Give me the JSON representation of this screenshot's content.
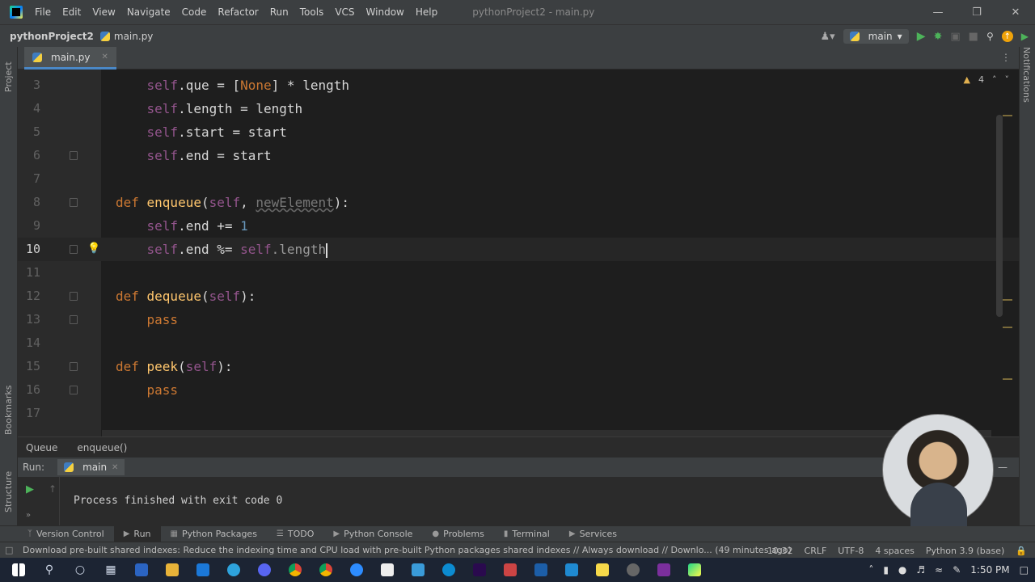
{
  "titlebar": {
    "menus": [
      "File",
      "Edit",
      "View",
      "Navigate",
      "Code",
      "Refactor",
      "Run",
      "Tools",
      "VCS",
      "Window",
      "Help"
    ],
    "window_title": "pythonProject2 - main.py"
  },
  "navbar": {
    "project": "pythonProject2",
    "file": "main.py",
    "run_config": "main"
  },
  "left_strip": {
    "project": "Project",
    "bookmarks": "Bookmarks",
    "structure": "Structure"
  },
  "right_strip": {
    "notifications": "Notifications"
  },
  "editor": {
    "tab": "main.py",
    "warnings": "4",
    "lines": [
      {
        "n": "3",
        "indent": "    ",
        "a": "self",
        "b": ".que = [",
        "c": "None",
        "d": "] * length"
      },
      {
        "n": "4",
        "indent": "    ",
        "a": "self",
        "b": ".length = length"
      },
      {
        "n": "5",
        "indent": "    ",
        "a": "self",
        "b": ".start = start"
      },
      {
        "n": "6",
        "indent": "    ",
        "a": "self",
        "b": ".end = start"
      },
      {
        "n": "7"
      },
      {
        "n": "8",
        "kw": "def ",
        "fn": "enqueue",
        "p1": "(",
        "s1": "self",
        ",": ", ",
        "un": "newElement",
        "p2": "):"
      },
      {
        "n": "9",
        "indent": "    ",
        "a": "self",
        "b": ".end += ",
        "num": "1"
      },
      {
        "n": "10",
        "indent": "    ",
        "a": "self",
        "b": ".end %= ",
        "a2": "self",
        "b2": ".length"
      },
      {
        "n": "11"
      },
      {
        "n": "12",
        "kw": "def ",
        "fn": "dequeue",
        "p1": "(",
        "s1": "self",
        "p2": "):"
      },
      {
        "n": "13",
        "indent": "    ",
        "kw": "pass"
      },
      {
        "n": "14"
      },
      {
        "n": "15",
        "kw": "def ",
        "fn": "peek",
        "p1": "(",
        "s1": "self",
        "p2": "):"
      },
      {
        "n": "16",
        "indent": "    ",
        "kw": "pass"
      },
      {
        "n": "17"
      }
    ]
  },
  "breadcrumbs": [
    "Queue",
    "enqueue()"
  ],
  "run": {
    "label": "Run:",
    "tab": "main",
    "output": "Process finished with exit code 0"
  },
  "toolwindows": [
    "Version Control",
    "Run",
    "Python Packages",
    "TODO",
    "Python Console",
    "Problems",
    "Terminal",
    "Services"
  ],
  "status": {
    "message": "Download pre-built shared indexes: Reduce the indexing time and CPU load with pre-built Python packages shared indexes // Always download // Downlo... (49 minutes ago)",
    "position": "10:32",
    "line_sep": "CRLF",
    "encoding": "UTF-8",
    "indent": "4 spaces",
    "interpreter": "Python 3.9 (base)"
  },
  "taskbar": {
    "time": "1:50 PM"
  }
}
